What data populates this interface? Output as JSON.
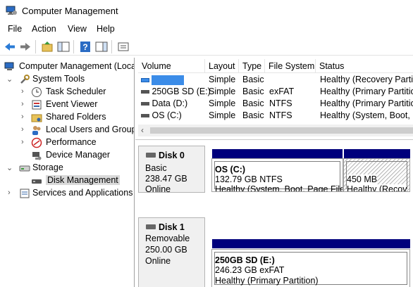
{
  "window": {
    "title": "Computer Management",
    "icon": "computer-management-icon"
  },
  "menu": {
    "file": "File",
    "action": "Action",
    "view": "View",
    "help": "Help"
  },
  "toolbar": {
    "icons": [
      "back-arrow-icon",
      "forward-arrow-icon",
      "up-folder-icon",
      "show-hide-tree-icon",
      "help-icon",
      "action-pane-icon",
      "properties-icon"
    ]
  },
  "tree": {
    "root": "Computer Management (Local",
    "system_tools": "System Tools",
    "task_scheduler": "Task Scheduler",
    "event_viewer": "Event Viewer",
    "shared_folders": "Shared Folders",
    "local_users": "Local Users and Groups",
    "performance": "Performance",
    "device_manager": "Device Manager",
    "storage": "Storage",
    "disk_management": "Disk Management",
    "services": "Services and Applications"
  },
  "volumes": {
    "headers": [
      "Volume",
      "Layout",
      "Type",
      "File System",
      "Status"
    ],
    "rows": [
      {
        "volume": "",
        "layout": "Simple",
        "type": "Basic",
        "fs": "",
        "status": "Healthy (Recovery Partitio"
      },
      {
        "volume": "250GB SD (E:)",
        "layout": "Simple",
        "type": "Basic",
        "fs": "exFAT",
        "status": "Healthy (Primary Partitio"
      },
      {
        "volume": "Data (D:)",
        "layout": "Simple",
        "type": "Basic",
        "fs": "NTFS",
        "status": "Healthy (Primary Partitio"
      },
      {
        "volume": "OS (C:)",
        "layout": "Simple",
        "type": "Basic",
        "fs": "NTFS",
        "status": "Healthy (System, Boot, Pa"
      }
    ]
  },
  "disks": [
    {
      "name": "Disk 0",
      "kind": "Basic",
      "size": "238.47 GB",
      "state": "Online",
      "partitions": [
        {
          "title": "OS  (C:)",
          "size": "132.79 GB NTFS",
          "status": "Healthy (System, Boot, Page File,"
        },
        {
          "title": "",
          "size": "450 MB",
          "status": "Healthy (Recov"
        }
      ]
    },
    {
      "name": "Disk 1",
      "kind": "Removable",
      "size": "250.00 GB",
      "state": "Online",
      "partitions": [
        {
          "title": "250GB SD  (E:)",
          "size": "246.23 GB exFAT",
          "status": "Healthy (Primary Partition)"
        }
      ]
    }
  ],
  "colors": {
    "partition_bar": "#00007c",
    "selection": "#3b8ce8"
  }
}
